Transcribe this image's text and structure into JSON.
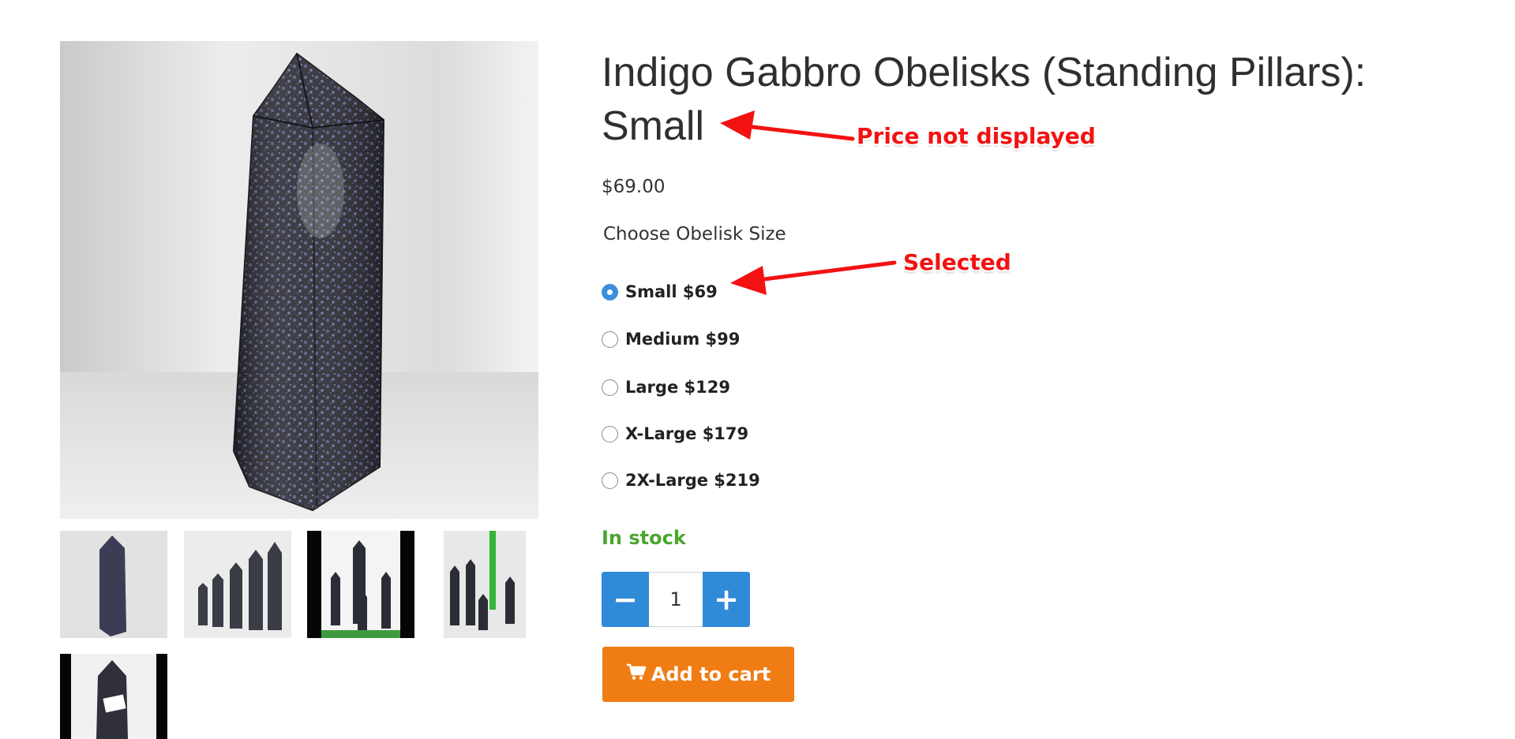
{
  "product": {
    "title": "Indigo Gabbro Obelisks (Standing Pillars): Small",
    "price": "$69.00",
    "option_label": "Choose Obelisk Size",
    "options": [
      {
        "label": "Small $69",
        "selected": true
      },
      {
        "label": "Medium $99",
        "selected": false
      },
      {
        "label": "Large $129",
        "selected": false
      },
      {
        "label": "X-Large $179",
        "selected": false
      },
      {
        "label": "2X-Large $219",
        "selected": false
      }
    ],
    "stock_status": "In stock",
    "quantity": "1",
    "quantity_minus_symbol": "−",
    "quantity_plus_symbol": "+",
    "add_to_cart_label": "Add to cart",
    "add_to_cart_icon": "shopping-cart-icon"
  },
  "gallery": {
    "main_image": "indigo-gabbro-obelisk-single",
    "thumbnails": [
      "obelisk-single-thumb",
      "obelisk-group-thumb",
      "obelisk-group-black-bg-thumb",
      "obelisk-group-with-ruler-thumb",
      "obelisk-labeled-thumb"
    ]
  },
  "annotations": {
    "price_note": "Price not displayed",
    "selected_note": "Selected"
  },
  "colors": {
    "accent_blue": "#2f8ad8",
    "radio_selected": "#3b8fdb",
    "in_stock_green": "#4aa72f",
    "add_to_cart_orange": "#f07c14",
    "annotation_red": "#f21212",
    "title_text": "#2f2f2f"
  }
}
